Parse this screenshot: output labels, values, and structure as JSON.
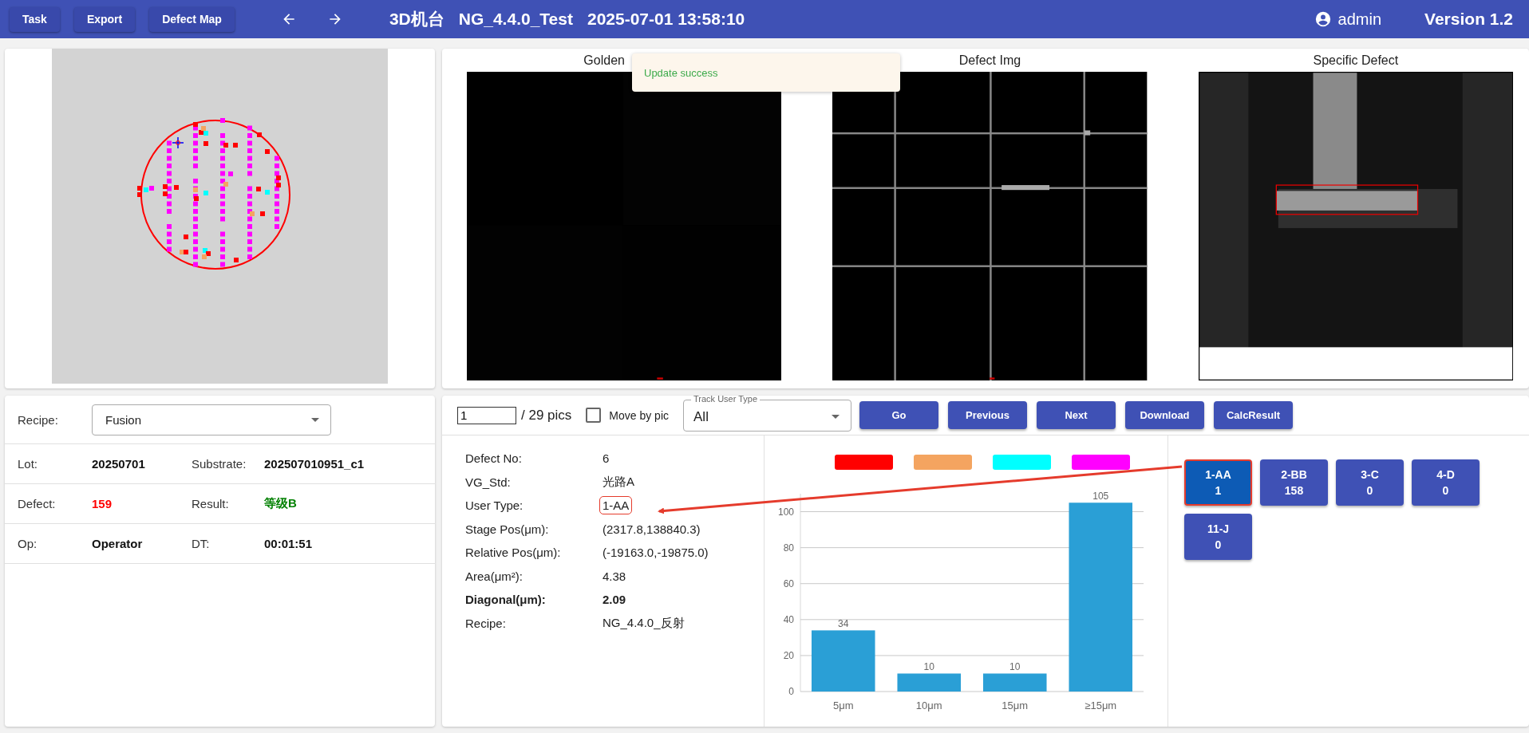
{
  "top_bar": {
    "buttons": [
      "Task",
      "Export",
      "Defect Map"
    ],
    "title_parts": [
      "3D机台",
      "NG_4.4.0_Test",
      "2025-07-01 13:58:10"
    ],
    "user": "admin",
    "version": "Version 1.2"
  },
  "images": [
    {
      "title": "Golden",
      "kind": "golden"
    },
    {
      "title": "Defect Img",
      "kind": "defect"
    },
    {
      "title": "Specific Defect",
      "kind": "specific"
    }
  ],
  "toast": {
    "message": "Update success"
  },
  "info": {
    "recipe_label": "Recipe:",
    "recipe_value": "Fusion",
    "rows": [
      [
        {
          "label": "Lot:",
          "value": "20250701"
        },
        {
          "label": "Substrate:",
          "value": "202507010951_c1"
        }
      ],
      [
        {
          "label": "Defect:",
          "value": "159",
          "color": "#ff0000"
        },
        {
          "label": "Result:",
          "value": "等级B",
          "color": "#008000"
        }
      ],
      [
        {
          "label": "Op:",
          "value": "Operator"
        },
        {
          "label": "DT:",
          "value": "00:01:51"
        }
      ]
    ]
  },
  "toolbar": {
    "page": "1",
    "total": "/ 29 pics",
    "move_by_pic": {
      "label": "Move by pic",
      "checked": false
    },
    "track_select": {
      "label": "Track User Type",
      "value": "All"
    },
    "buttons": [
      "Go",
      "Previous",
      "Next",
      "Download",
      "CalcResult"
    ]
  },
  "details": [
    {
      "label": "Defect No:",
      "value": "6",
      "bold": false,
      "highlighted": false
    },
    {
      "label": "VG_Std:",
      "value": "光路A",
      "bold": false,
      "highlighted": false
    },
    {
      "label": "User Type:",
      "value": "1-AA",
      "bold": false,
      "highlighted": true
    },
    {
      "label": "Stage Pos(μm):",
      "value": "(2317.8,138840.3)",
      "bold": false,
      "highlighted": false
    },
    {
      "label": "Relative Pos(μm):",
      "value": "(-19163.0,-19875.0)",
      "bold": false,
      "highlighted": false
    },
    {
      "label": "Area(μm²):",
      "value": "4.38",
      "bold": false,
      "highlighted": false
    },
    {
      "label": "Diagonal(μm):",
      "value": "2.09",
      "bold": true,
      "highlighted": false
    },
    {
      "label": "Recipe:",
      "value": "NG_4.4.0_反射",
      "bold": false,
      "highlighted": false
    }
  ],
  "chart": {
    "legend": [
      {
        "color": "#ff0000"
      },
      {
        "color": "#f4a460"
      },
      {
        "color": "#00ffff"
      },
      {
        "color": "#ff00ff"
      }
    ],
    "chart_data": {
      "type": "bar",
      "categories": [
        "5μm",
        "10μm",
        "15μm",
        "≥15μm"
      ],
      "series": [
        {
          "color": "#2a9fd6",
          "values": [
            34,
            10,
            10,
            105
          ]
        }
      ],
      "ylim": [
        0,
        110
      ],
      "yticks": [
        0,
        20,
        40,
        60,
        80,
        100
      ],
      "grid": true,
      "data_labels": true
    }
  },
  "user_types": [
    {
      "name": "1-AA",
      "count": "1",
      "selected": true
    },
    {
      "name": "2-BB",
      "count": "158",
      "selected": false
    },
    {
      "name": "3-C",
      "count": "0",
      "selected": false
    },
    {
      "name": "4-D",
      "count": "0",
      "selected": false
    },
    {
      "name": "11-J",
      "count": "0",
      "selected": false
    }
  ]
}
